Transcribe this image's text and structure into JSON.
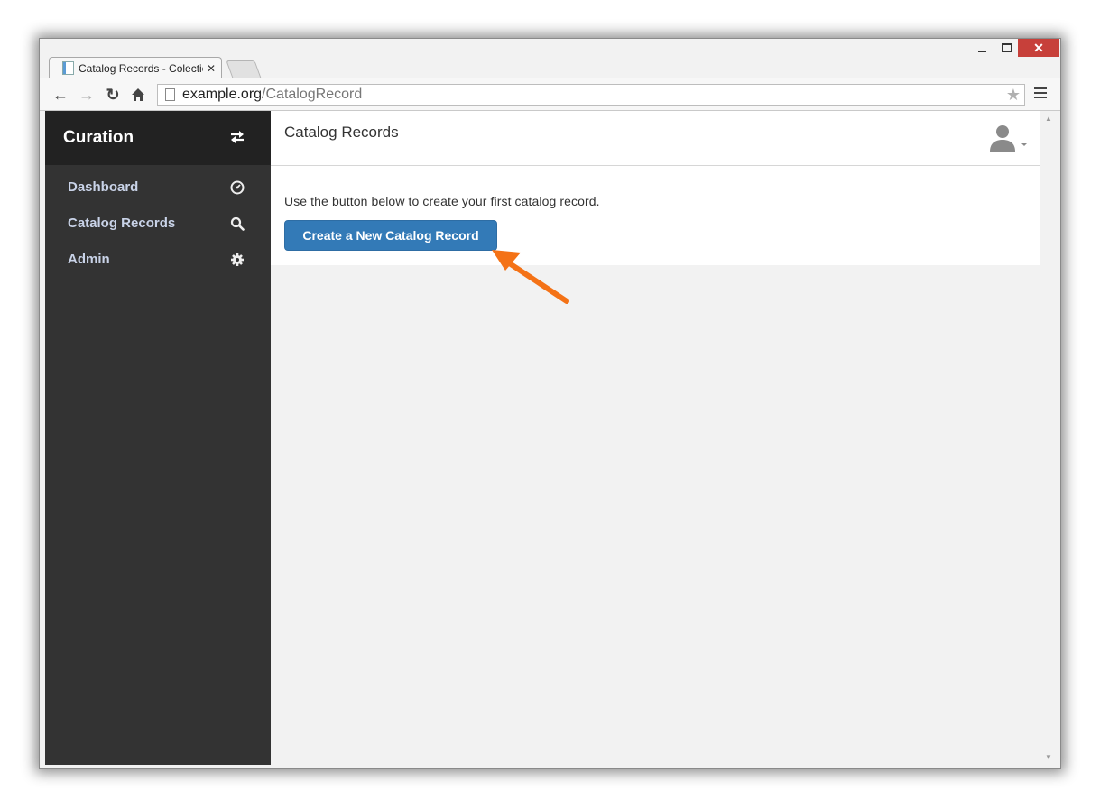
{
  "browser": {
    "tab_title": "Catalog Records - Colectio",
    "url_domain": "example.org",
    "url_path": "/CatalogRecord"
  },
  "sidebar": {
    "brand": "Curation",
    "items": [
      {
        "label": "Dashboard",
        "icon": "dashboard-icon"
      },
      {
        "label": "Catalog Records",
        "icon": "search-icon"
      },
      {
        "label": "Admin",
        "icon": "gear-icon"
      }
    ]
  },
  "main": {
    "title": "Catalog Records",
    "intro": "Use the button below to create your first catalog record.",
    "create_button": "Create a New Catalog Record"
  },
  "colors": {
    "sidebar_bg": "#333333",
    "brand_bg": "#222222",
    "primary": "#337ab7",
    "annotation_arrow": "#f47216"
  }
}
